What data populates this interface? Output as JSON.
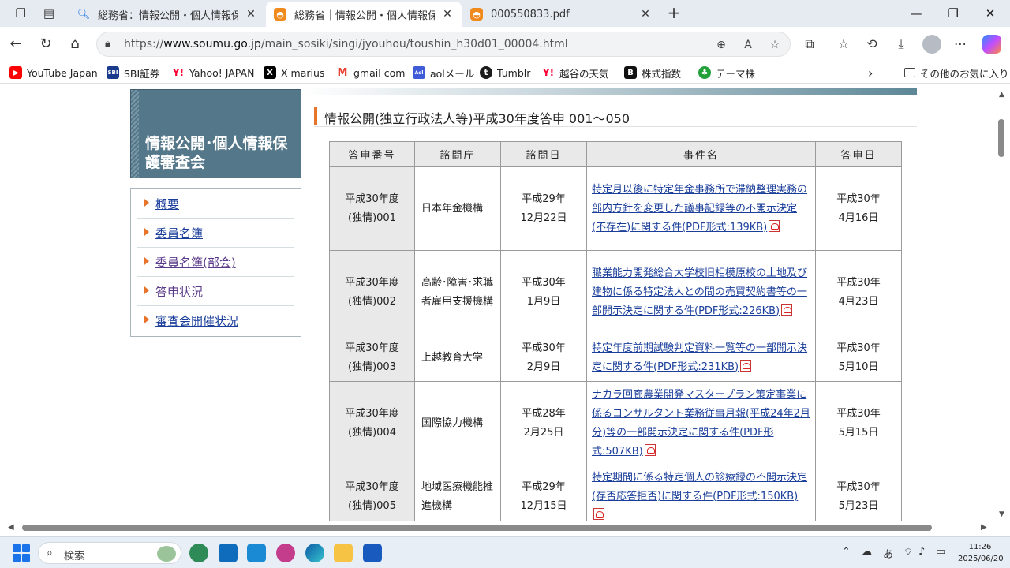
{
  "browser": {
    "tabs": [
      {
        "title": "総務省：情報公開・個人情報保護審",
        "favicon": "search-icon",
        "active": false
      },
      {
        "title": "総務省｜情報公開・個人情報保護",
        "favicon": "soumu-icon",
        "active": true
      },
      {
        "title": "000550833.pdf",
        "favicon": "soumu-icon",
        "active": false
      }
    ],
    "url_prefix": "https://",
    "url_host": "www.soumu.go.jp",
    "url_path": "/main_sosiki/singi/jyouhou/toushin_h30d01_00004.html",
    "bookmarks": [
      {
        "label": "YouTube Japan",
        "icon": "youtube-icon",
        "color": "#ff0000"
      },
      {
        "label": "SBI証券",
        "icon": "sbi-icon",
        "color": "#1a3b8c"
      },
      {
        "label": "Yahoo! JAPAN",
        "icon": "yahoo-icon",
        "color": "#ff0033"
      },
      {
        "label": "X marius",
        "icon": "x-icon",
        "color": "#000000"
      },
      {
        "label": "gmail com",
        "icon": "gmail-icon",
        "color": "#ea4335"
      },
      {
        "label": "aolメール",
        "icon": "aol-icon",
        "color": "#3f5bd8"
      },
      {
        "label": "Tumblr",
        "icon": "tumblr-icon",
        "color": "#1c1c1c"
      },
      {
        "label": "越谷の天気",
        "icon": "yahoo-icon",
        "color": "#ff0033"
      },
      {
        "label": "株式指数",
        "icon": "b-icon",
        "color": "#111111"
      },
      {
        "label": "テーマ株",
        "icon": "tree-icon",
        "color": "#22a13a"
      }
    ],
    "other_bookmarks": "その他のお気に入り"
  },
  "page": {
    "sidebar_title": "情報公開･個人情報保護審査会",
    "menu": [
      {
        "label": "概要"
      },
      {
        "label": "委員名簿"
      },
      {
        "label": "委員名簿(部会)"
      },
      {
        "label": "答申状況"
      },
      {
        "label": "審査会開催状況"
      }
    ],
    "heading": "情報公開(独立行政法人等)平成30年度答申 001〜050",
    "table": {
      "headers": [
        "答申番号",
        "諮問庁",
        "諮問日",
        "事件名",
        "答申日"
      ],
      "rows": [
        {
          "no1": "平成30年度",
          "no2": "(独情)001",
          "org": "日本年金機構",
          "inq1": "平成29年",
          "inq2": "12月22日",
          "case": "特定月以後に特定年金事務所で滞納整理実務の部内方針を変更した議事記録等の不開示決定(不存在)に関する件(PDF形式:139KB)",
          "ans1": "平成30年",
          "ans2": "4月16日"
        },
        {
          "no1": "平成30年度",
          "no2": "(独情)002",
          "org": "高齢･障害･求職者雇用支援機構",
          "inq1": "平成30年",
          "inq2": "1月9日",
          "case": "職業能力開発総合大学校旧相模原校の土地及び建物に係る特定法人との間の売買契約書等の一部開示決定に関する件(PDF形式:226KB)",
          "ans1": "平成30年",
          "ans2": "4月23日"
        },
        {
          "no1": "平成30年度",
          "no2": "(独情)003",
          "org": "上越教育大学",
          "inq1": "平成30年",
          "inq2": "2月9日",
          "case": "特定年度前期試験判定資料一覧等の一部開示決定に関する件(PDF形式:231KB)",
          "ans1": "平成30年",
          "ans2": "5月10日"
        },
        {
          "no1": "平成30年度",
          "no2": "(独情)004",
          "org": "国際協力機構",
          "inq1": "平成28年",
          "inq2": "2月25日",
          "case": "ナカラ回廊農業開発マスタープラン策定事業に係るコンサルタント業務従事月報(平成24年2月分)等の一部開示決定に関する件(PDF形式:507KB)",
          "ans1": "平成30年",
          "ans2": "5月15日"
        },
        {
          "no1": "平成30年度",
          "no2": "(独情)005",
          "org": "地域医療機能推進機構",
          "inq1": "平成29年",
          "inq2": "12月15日",
          "case": "特定期間に係る特定個人の診療録の不開示決定(存否応答拒否)に関する件(PDF形式:150KB)",
          "ans1": "平成30年",
          "ans2": "5月23日"
        }
      ]
    }
  },
  "taskbar": {
    "search_placeholder": "検索",
    "ime": "あ",
    "time": "11:26",
    "date": "2025/06/20"
  }
}
